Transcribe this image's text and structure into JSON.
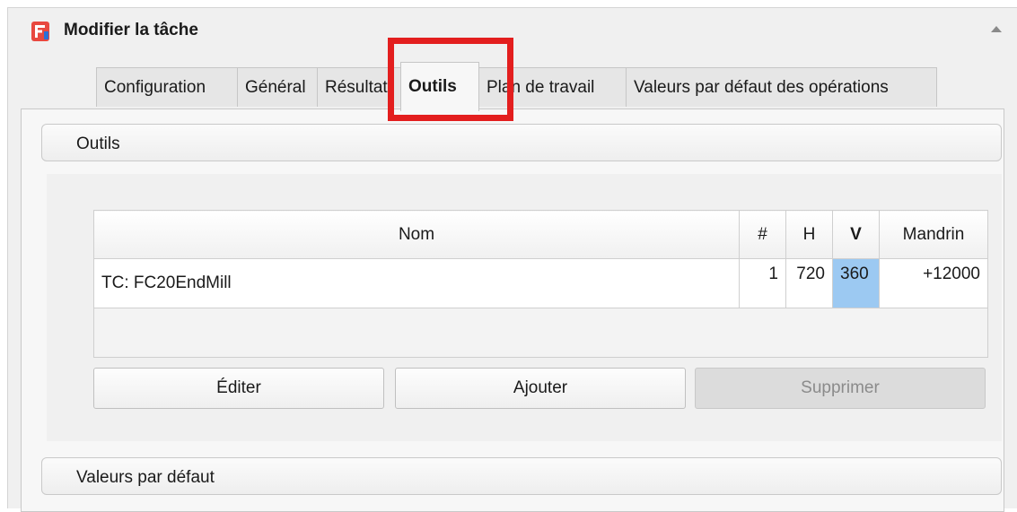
{
  "titlebar": {
    "title": "Modifier la tâche"
  },
  "tabs": [
    {
      "label": "Configuration"
    },
    {
      "label": "Général"
    },
    {
      "label": "Résultat"
    },
    {
      "label": "Outils"
    },
    {
      "label": "Plan de travail"
    },
    {
      "label": "Valeurs par défaut des opérations"
    }
  ],
  "active_tab": "Outils",
  "sections": {
    "tools_header": "Outils",
    "defaults_header": "Valeurs par défaut"
  },
  "table": {
    "columns": [
      "Nom",
      "#",
      "H",
      "V",
      "Mandrin"
    ],
    "rows": [
      {
        "name": "TC: FC20EndMill",
        "number": "1",
        "h": "720",
        "v": "360",
        "spindle": "+12000"
      }
    ]
  },
  "buttons": {
    "edit": "Éditer",
    "add": "Ajouter",
    "delete": "Supprimer"
  },
  "colors": {
    "highlight": "#e31e1e",
    "selection": "#9cc9f2",
    "icon_red": "#e8483f"
  }
}
